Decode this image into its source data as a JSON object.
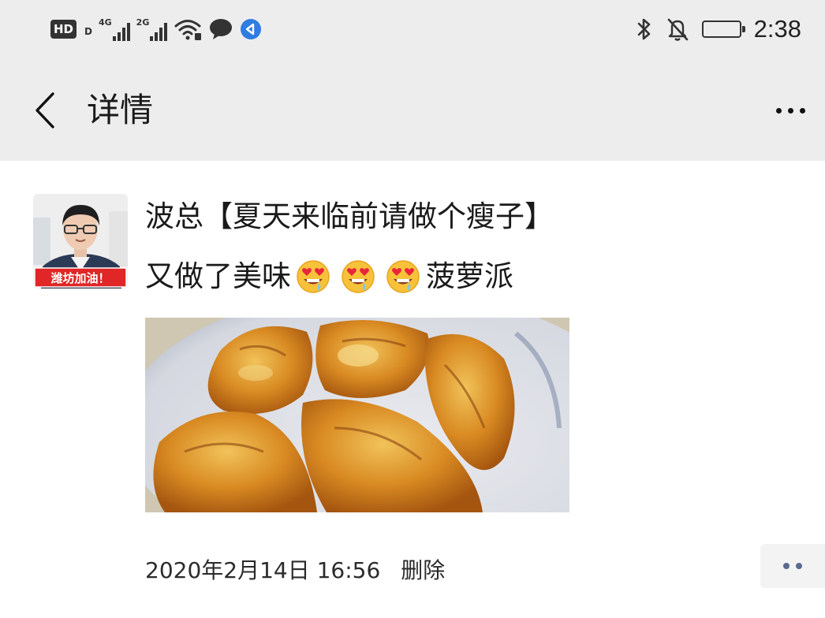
{
  "status_bar": {
    "hd_label": "HD",
    "hd_sub": "D",
    "network1_label": "4G",
    "network2_label": "2G",
    "time": "2:38"
  },
  "nav": {
    "title": "详情"
  },
  "post": {
    "author": "波总【夏天来临前请做个瘦子】",
    "avatar_caption": "潍坊加油！",
    "text_before_emoji": "又做了美味",
    "emojis": [
      "drooling-heart-eyes-emoji",
      "drooling-heart-eyes-emoji",
      "drooling-heart-eyes-emoji"
    ],
    "text_after_emoji": "菠萝派",
    "timestamp": "2020年2月14日 16:56",
    "delete_label": "删除"
  },
  "colors": {
    "bar_background": "#ededed",
    "page_background": "#ffffff",
    "link_dots": "#5b6a8f"
  }
}
